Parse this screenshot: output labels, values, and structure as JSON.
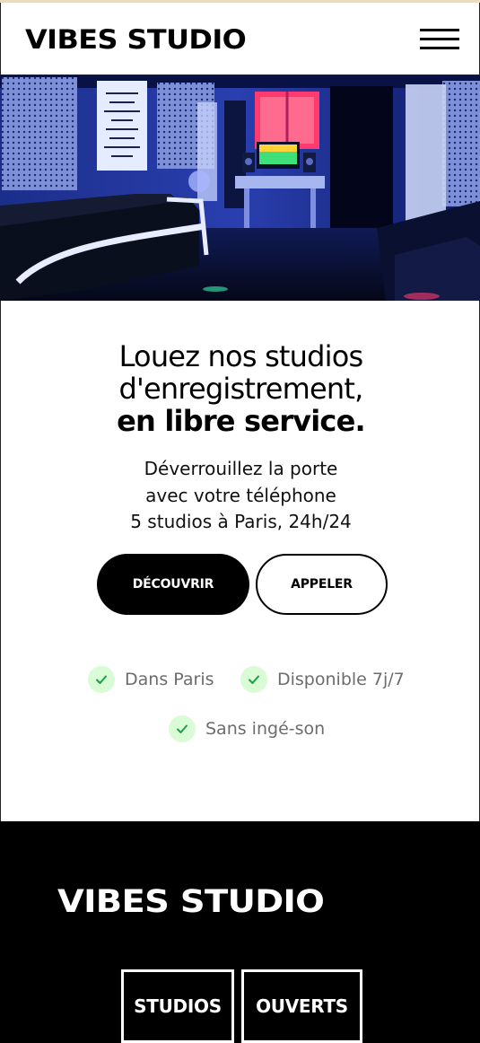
{
  "header": {
    "brand": "VIBES STUDIO",
    "menu_icon": "hamburger-menu-icon"
  },
  "hero": {
    "image": "recording-studio-photo"
  },
  "main": {
    "headline_line1": "Louez nos studios",
    "headline_line2": "d'enregistrement,",
    "headline_line3": "en libre service.",
    "sub_line1": "Déverrouillez la porte",
    "sub_line2": "avec votre téléphone",
    "sub_line3": "5 studios à Paris, 24h/24",
    "primary_button": "DÉCOUVRIR",
    "secondary_button": "APPELER",
    "features": [
      {
        "label": "Dans Paris",
        "icon": "check-icon"
      },
      {
        "label": "Disponible 7j/7",
        "icon": "check-icon"
      },
      {
        "label": "Sans ingé-son",
        "icon": "check-icon"
      }
    ]
  },
  "footer": {
    "brand": "VIBES STUDIO",
    "tag1": "STUDIOS",
    "tag2": "OUVERTS"
  },
  "colors": {
    "accent_green": "#d9fbd6",
    "check_green": "#1c9e4a",
    "text_muted": "#6c6c6c"
  }
}
